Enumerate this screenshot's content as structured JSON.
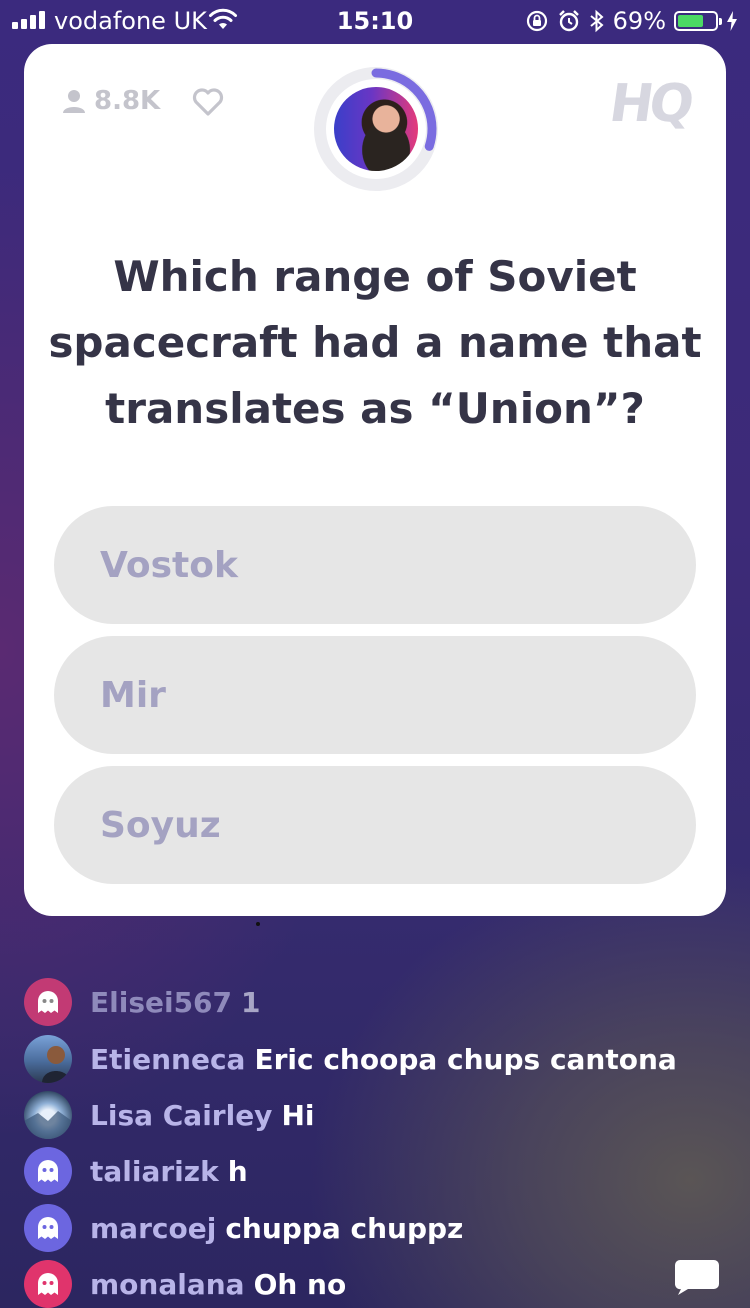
{
  "status_bar": {
    "carrier": "vodafone UK",
    "time": "15:10",
    "battery_percent": "69%",
    "battery_level": 0.69,
    "signal_bars": 4
  },
  "card": {
    "viewer_count": "8.8K",
    "logo": "HQ",
    "timer_progress": 0.3,
    "question": "Which range of Soviet spacecraft had a name that translates as “Union”?",
    "answers": [
      "Vostok",
      "Mir",
      "Soyuz"
    ]
  },
  "chat": {
    "messages": [
      {
        "user": "Elisei567",
        "text": "1",
        "avatar": "ghost-avatar",
        "avatar_color": "#c23a74",
        "faded": true
      },
      {
        "user": "Etienneca",
        "text": "Eric choopa chups cantona",
        "avatar": "photo-avatar",
        "avatar_color": "#5b7fb0",
        "faded": false
      },
      {
        "user": "Lisa Cairley",
        "text": "Hi",
        "avatar": "photo-avatar",
        "avatar_color": "#a9c1de",
        "faded": false
      },
      {
        "user": "taliarizk",
        "text": "h",
        "avatar": "ghost-avatar",
        "avatar_color": "#6c66e0",
        "faded": false
      },
      {
        "user": "marcoej",
        "text": "chuppa chuppz",
        "avatar": "ghost-avatar",
        "avatar_color": "#6c66e0",
        "faded": false
      },
      {
        "user": "monalana",
        "text": "Oh no",
        "avatar": "ghost-avatar",
        "avatar_color": "#e0346c",
        "faded": false
      }
    ]
  },
  "colors": {
    "answer_bg": "#e6e6e6",
    "answer_text": "#a4a2c2",
    "timer_ring": "#7a6ce0",
    "question_text": "#353447"
  }
}
